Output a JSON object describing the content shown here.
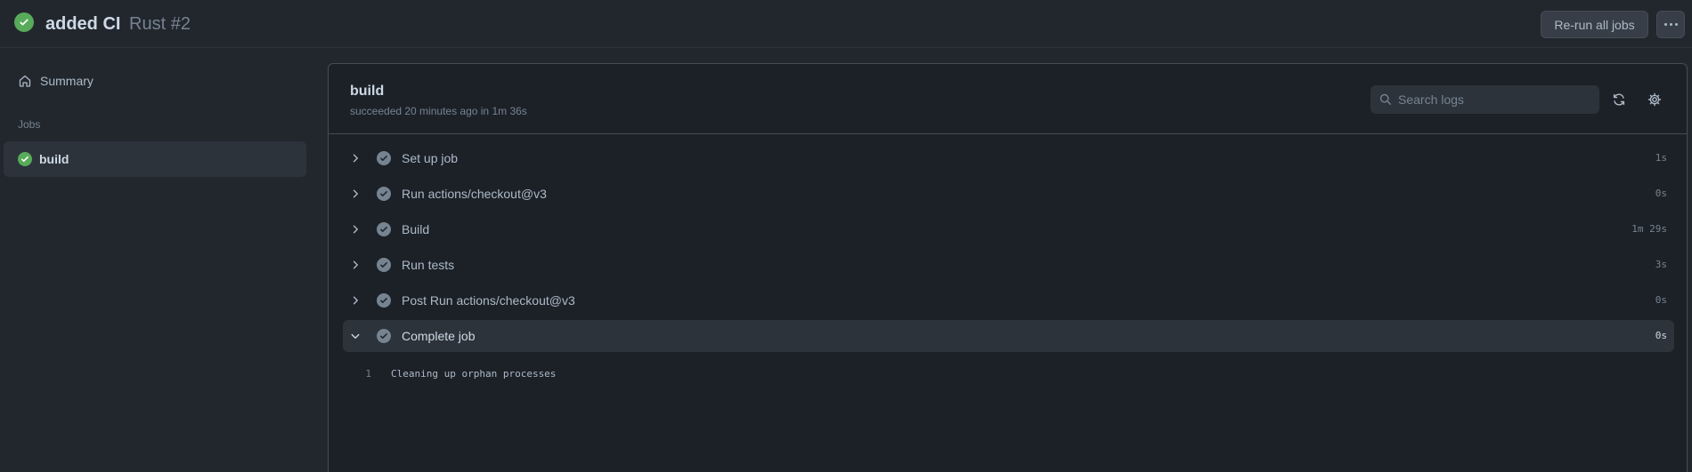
{
  "header": {
    "run_name": "added CI",
    "workflow": "Rust #2",
    "rerun_label": "Re-run all jobs",
    "status": "success"
  },
  "sidebar": {
    "summary_label": "Summary",
    "jobs_heading": "Jobs",
    "jobs": [
      {
        "label": "build",
        "status": "success"
      }
    ]
  },
  "job": {
    "title": "build",
    "meta": "succeeded 20 minutes ago in 1m 36s",
    "search_placeholder": "Search logs"
  },
  "steps": [
    {
      "name": "Set up job",
      "duration": "1s",
      "expanded": false
    },
    {
      "name": "Run actions/checkout@v3",
      "duration": "0s",
      "expanded": false
    },
    {
      "name": "Build",
      "duration": "1m 29s",
      "expanded": false
    },
    {
      "name": "Run tests",
      "duration": "3s",
      "expanded": false
    },
    {
      "name": "Post Run actions/checkout@v3",
      "duration": "0s",
      "expanded": false
    },
    {
      "name": "Complete job",
      "duration": "0s",
      "expanded": true
    }
  ],
  "log": [
    {
      "line": "1",
      "text": "Cleaning up orphan processes"
    }
  ],
  "colors": {
    "background": "#22272e",
    "panel": "#1c2128",
    "success": "#57ab5a",
    "step_check": "#768390",
    "text": "#adbac7"
  }
}
